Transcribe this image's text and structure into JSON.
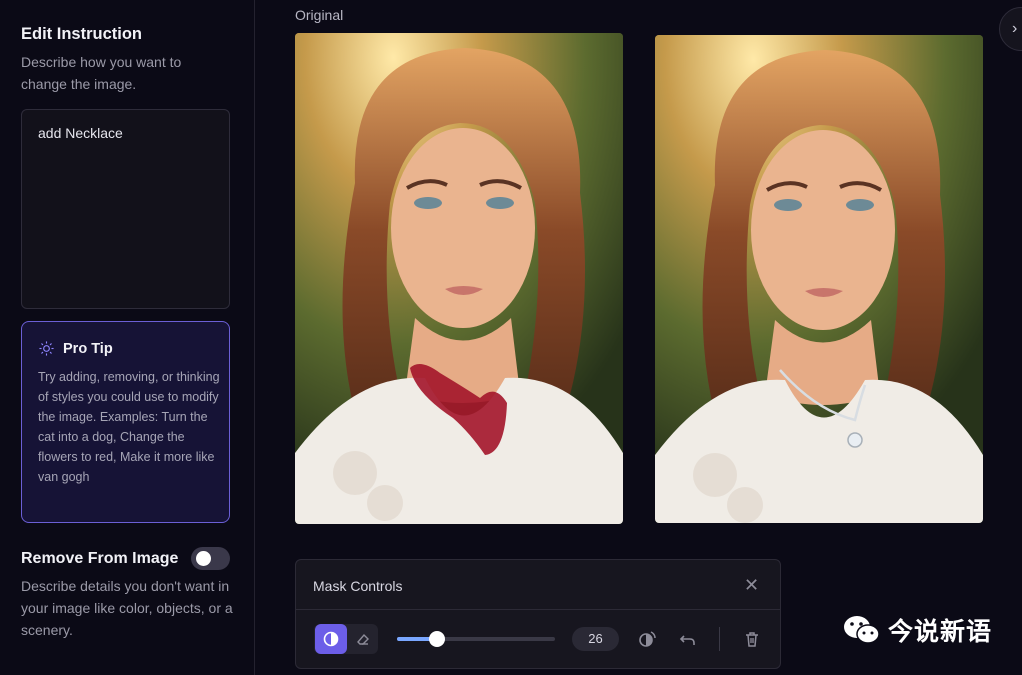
{
  "sidebar": {
    "edit_title": "Edit Instruction",
    "edit_desc": "Describe how you want to change the image.",
    "instruction_value": "add Necklace",
    "protip": {
      "title": "Pro Tip",
      "text": "Try adding, removing, or thinking of styles you could use to modify the image. Examples: Turn the cat into a dog, Change the flowers to red, Make it more like van gogh"
    },
    "remove_title": "Remove From Image",
    "remove_toggle_on": false,
    "remove_desc": "Describe details you don't want in your image like color, objects, or a scenery."
  },
  "main": {
    "original_label": "Original"
  },
  "mask_controls": {
    "title": "Mask Controls",
    "brush_size": "26",
    "slider_fraction": 0.25
  },
  "watermark": {
    "text": "今说新语"
  },
  "colors": {
    "accent": "#6c5ee8",
    "protip_border": "#6b5fd6",
    "slider_fill": "#7aa7ff",
    "mask_paint": "#a3152a"
  },
  "icons": {
    "protip": "sun-icon",
    "expand": "chevron-right-icon",
    "close": "close-icon",
    "mask_mode": "contrast-icon",
    "eraser": "eraser-icon",
    "invert": "invert-mask-icon",
    "undo": "undo-icon",
    "delete": "trash-icon",
    "watermark": "wechat-icon"
  }
}
